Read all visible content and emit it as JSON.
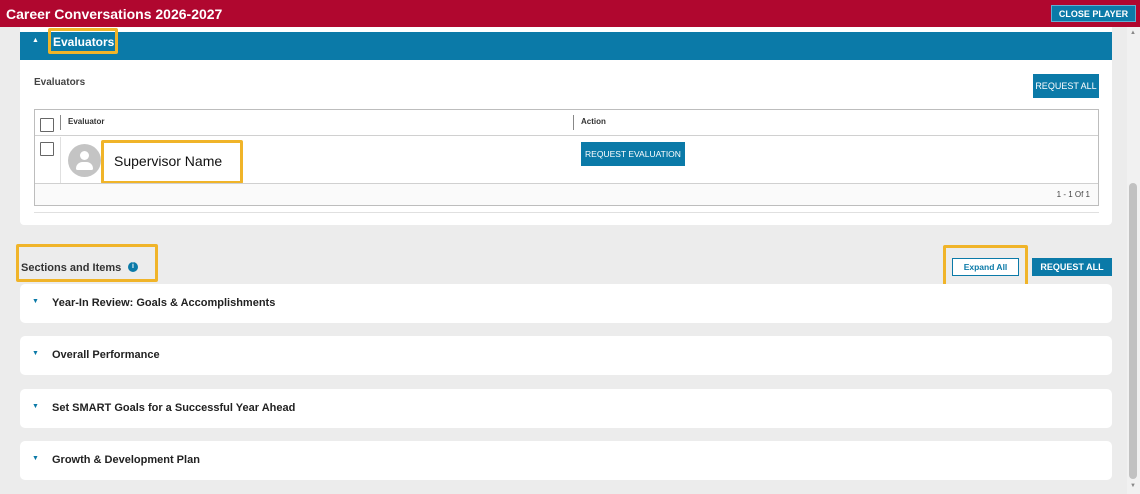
{
  "window": {
    "title": "Career Conversations 2026-2027",
    "close_label": "CLOSE PLAYER"
  },
  "evaluators_panel": {
    "header_label": "Evaluators",
    "subtitle": "Evaluators",
    "request_all_label": "REQUEST ALL",
    "table": {
      "columns": [
        "Evaluator",
        "Action"
      ],
      "rows": [
        {
          "name": "Supervisor Name",
          "action_label": "REQUEST EVALUATION"
        }
      ],
      "pagination": "1 - 1 Of 1"
    }
  },
  "sections_panel": {
    "title": "Sections and Items",
    "info_glyph": "i",
    "expand_all_label": "Expand All",
    "request_all_label": "REQUEST ALL",
    "sections": [
      {
        "name": "Year-In Review: Goals & Accomplishments"
      },
      {
        "name": "Overall Performance"
      },
      {
        "name": "Set SMART Goals for a Successful Year Ahead"
      },
      {
        "name": "Growth & Development Plan"
      }
    ]
  },
  "glyphs": {
    "caret_up": "▲",
    "caret_down": "▼"
  },
  "colors": {
    "brand_red": "#b0072f",
    "accent_blue": "#0b7aa8",
    "highlight": "#f0b429"
  }
}
